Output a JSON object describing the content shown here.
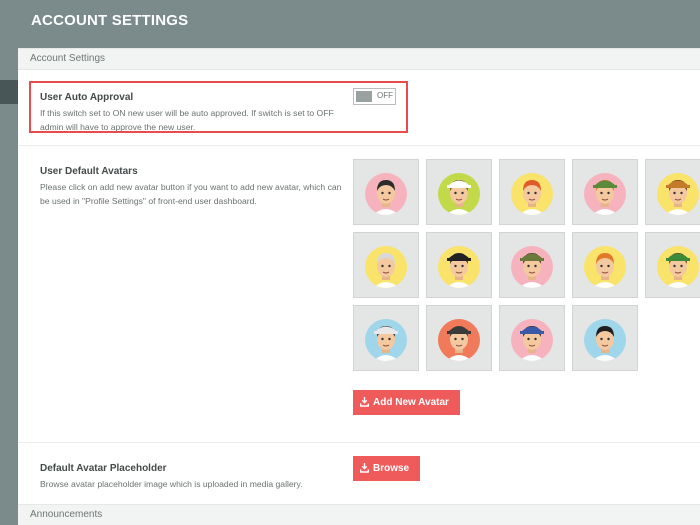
{
  "header": {
    "title": "ACCOUNT SETTINGS"
  },
  "sections": {
    "account": {
      "label": "Account Settings"
    },
    "announcements": {
      "label": "Announcements"
    }
  },
  "auto_approval": {
    "title": "User Auto Approval",
    "description": "If this switch set to ON new user will be auto approved. If switch is set to OFF admin will have to approve the new user.",
    "toggle_state": "OFF"
  },
  "default_avatars": {
    "title": "User Default Avatars",
    "description": "Please click on add new avatar button if you want to add new avatar, which can be used in \"Profile Settings\" of front-end user dashboard.",
    "add_button_label": "Add New Avatar",
    "avatars": [
      {
        "name": "glasses-man",
        "bg": "#f6b3bd",
        "hair": "#2b2b2b",
        "hat": "none"
      },
      {
        "name": "sailor",
        "bg": "#c2d94a",
        "hair": "#7a4a22",
        "hat": "#ffffff"
      },
      {
        "name": "redhead-woman",
        "bg": "#f9e36a",
        "hair": "#e05a2a",
        "hat": "none"
      },
      {
        "name": "beanie-man",
        "bg": "#f6b3bd",
        "hair": "#d9742a",
        "hat": "#5a8a3a"
      },
      {
        "name": "cowboy",
        "bg": "#f9e36a",
        "hair": "#5a3a1a",
        "hat": "#c47a2a"
      },
      {
        "name": "old-man",
        "bg": "#f9e36a",
        "hair": "#d8d8d8",
        "hat": "none"
      },
      {
        "name": "pirate",
        "bg": "#f9e36a",
        "hair": "#2b2b2b",
        "hat": "#222222"
      },
      {
        "name": "soldier",
        "bg": "#f6b3bd",
        "hair": "#4a3a2a",
        "hat": "#6b7a3a"
      },
      {
        "name": "ginger-glasses",
        "bg": "#f9e36a",
        "hair": "#e07a2a",
        "hat": "none"
      },
      {
        "name": "green-cap",
        "bg": "#f9e36a",
        "hair": "#6a3a1a",
        "hat": "#3a8a3a"
      },
      {
        "name": "astronaut",
        "bg": "#9fd6ea",
        "hair": "#333333",
        "hat": "#e8e8e8"
      },
      {
        "name": "racer",
        "bg": "#f07a5a",
        "hair": "#444444",
        "hat": "#3a3a3a"
      },
      {
        "name": "police",
        "bg": "#f6b3bd",
        "hair": "#2b2b2b",
        "hat": "#3a5aa8"
      },
      {
        "name": "punk",
        "bg": "#9fd6ea",
        "hair": "#1f1f1f",
        "hat": "none"
      }
    ]
  },
  "placeholder": {
    "title": "Default Avatar Placeholder",
    "description": "Browse avatar placeholder image which is uploaded in media gallery.",
    "browse_label": "Browse"
  },
  "icons": {
    "upload": "download-tray-icon"
  }
}
